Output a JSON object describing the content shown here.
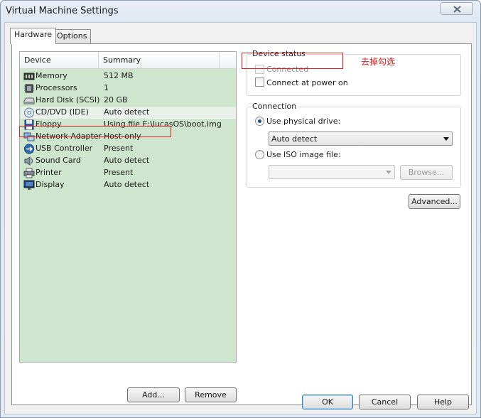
{
  "window": {
    "title": "Virtual Machine Settings"
  },
  "tabs": [
    {
      "label": "Hardware",
      "active": true
    },
    {
      "label": "Options",
      "active": false
    }
  ],
  "device_list": {
    "columns": [
      "Device",
      "Summary"
    ],
    "rows": [
      {
        "device": "Memory",
        "summary": "512 MB",
        "icon": "memory-icon"
      },
      {
        "device": "Processors",
        "summary": "1",
        "icon": "processor-icon"
      },
      {
        "device": "Hard Disk (SCSI)",
        "summary": "20 GB",
        "icon": "hard-disk-icon"
      },
      {
        "device": "CD/DVD (IDE)",
        "summary": "Auto detect",
        "icon": "cd-dvd-icon",
        "selected": true
      },
      {
        "device": "Floppy",
        "summary": "Using file E:\\lucasOS\\boot.img",
        "icon": "floppy-icon"
      },
      {
        "device": "Network Adapter",
        "summary": "Host-only",
        "icon": "network-adapter-icon"
      },
      {
        "device": "USB Controller",
        "summary": "Present",
        "icon": "usb-icon"
      },
      {
        "device": "Sound Card",
        "summary": "Auto detect",
        "icon": "sound-card-icon"
      },
      {
        "device": "Printer",
        "summary": "Present",
        "icon": "printer-icon"
      },
      {
        "device": "Display",
        "summary": "Auto detect",
        "icon": "display-icon"
      }
    ]
  },
  "list_buttons": {
    "add": "Add...",
    "remove": "Remove"
  },
  "device_status": {
    "legend": "Device status",
    "connected": {
      "label": "Connected",
      "checked": false,
      "enabled": false
    },
    "connect_at_power_on": {
      "label": "Connect at power on",
      "checked": false,
      "enabled": true
    }
  },
  "annotation": {
    "note": "去掉勾选"
  },
  "connection": {
    "legend": "Connection",
    "physical": {
      "label": "Use physical drive:",
      "selected": true
    },
    "physical_value": "Auto detect",
    "iso": {
      "label": "Use ISO image file:",
      "selected": false
    },
    "iso_value": "",
    "browse": "Browse..."
  },
  "advanced": "Advanced...",
  "footer": {
    "ok": "OK",
    "cancel": "Cancel",
    "help": "Help"
  },
  "colors": {
    "list_background": "#cde6cd",
    "annotation_red": "#e02020"
  }
}
